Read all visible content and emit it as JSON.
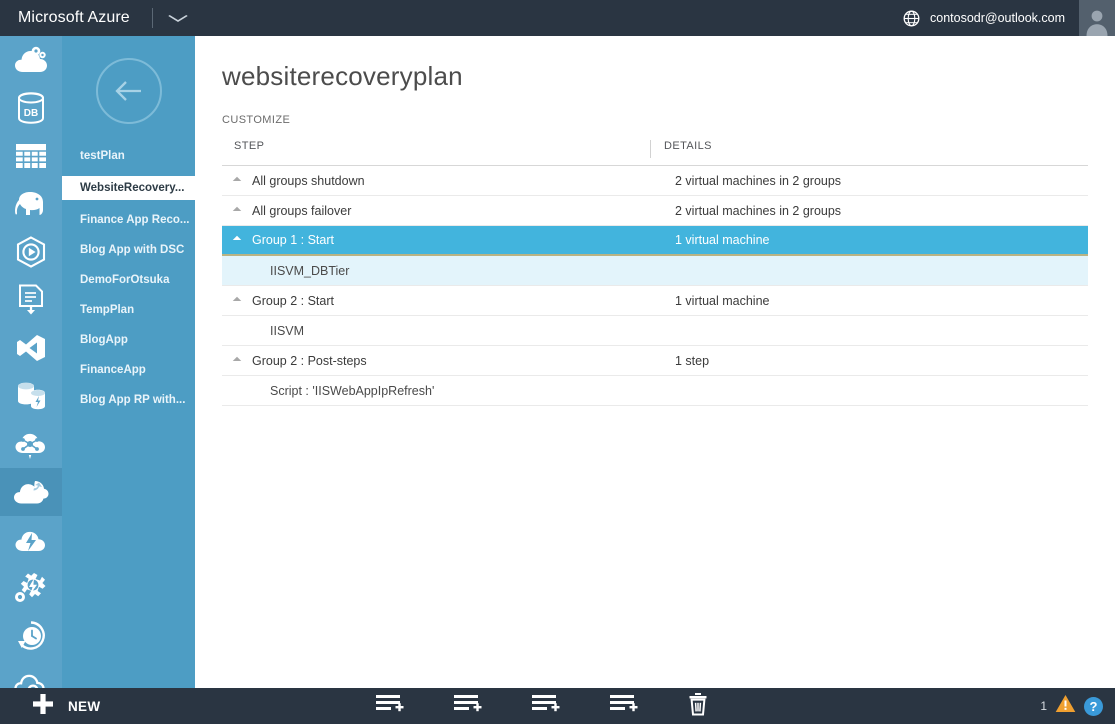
{
  "topbar": {
    "brand": "Microsoft Azure",
    "chevron_icon": "chevron-down-icon",
    "globe_icon": "globe-icon",
    "account": "contosodr@outlook.com",
    "avatar_icon": "user-avatar-icon"
  },
  "rail": {
    "items": [
      {
        "icon": "cloud-services-icon",
        "active": false
      },
      {
        "icon": "sql-database-icon",
        "active": false
      },
      {
        "icon": "storage-table-icon",
        "active": false
      },
      {
        "icon": "hdinsight-elephant-icon",
        "active": false
      },
      {
        "icon": "media-services-icon",
        "active": false
      },
      {
        "icon": "import-export-icon",
        "active": false
      },
      {
        "icon": "visual-studio-icon",
        "active": false
      },
      {
        "icon": "cache-storage-icon",
        "active": false
      },
      {
        "icon": "virtual-network-cloud-icon",
        "active": false
      },
      {
        "icon": "recovery-services-cloud-icon",
        "active": true
      },
      {
        "icon": "cloud-power-icon",
        "active": false
      },
      {
        "icon": "automation-gear-icon",
        "active": false
      },
      {
        "icon": "scheduler-clock-icon",
        "active": false
      },
      {
        "icon": "cloud-link-icon",
        "active": false
      }
    ]
  },
  "sidebar": {
    "back_icon": "back-arrow-icon",
    "items": [
      {
        "label": "testPlan",
        "selected": false
      },
      {
        "label": "WebsiteRecovery...",
        "selected": true
      },
      {
        "label": "Finance App Reco...",
        "selected": false
      },
      {
        "label": "Blog App with DSC",
        "selected": false
      },
      {
        "label": "DemoForOtsuka",
        "selected": false
      },
      {
        "label": "TempPlan",
        "selected": false
      },
      {
        "label": "BlogApp",
        "selected": false
      },
      {
        "label": "FinanceApp",
        "selected": false
      },
      {
        "label": "Blog App RP with...",
        "selected": false
      }
    ]
  },
  "main": {
    "title": "websiterecoveryplan",
    "section_label": "CUSTOMIZE",
    "table": {
      "columns": [
        "STEP",
        "DETAILS"
      ],
      "rows": [
        {
          "step": "All groups shutdown",
          "details": "2 virtual machines in 2 groups",
          "expandable": true,
          "child": false,
          "selected": false
        },
        {
          "step": "All groups failover",
          "details": "2 virtual machines in 2 groups",
          "expandable": true,
          "child": false,
          "selected": false
        },
        {
          "step": "Group 1 : Start",
          "details": "1 virtual machine",
          "expandable": true,
          "child": false,
          "selected": true
        },
        {
          "step": "IISVM_DBTier",
          "details": "",
          "expandable": false,
          "child": true,
          "selected": false
        },
        {
          "step": "Group 2 : Start",
          "details": "1 virtual machine",
          "expandable": true,
          "child": false,
          "selected": false
        },
        {
          "step": "IISVM",
          "details": "",
          "expandable": false,
          "child": true,
          "selected": false
        },
        {
          "step": "Group 2 : Post-steps",
          "details": "1 step",
          "expandable": true,
          "child": false,
          "selected": false
        },
        {
          "step": "Script : 'IISWebAppIpRefresh'",
          "details": "",
          "expandable": false,
          "child": true,
          "selected": false
        }
      ]
    }
  },
  "cmdbar": {
    "new_label": "NEW",
    "new_icon": "plus-icon",
    "commands": [
      {
        "icon": "add-step-list-icon"
      },
      {
        "icon": "add-step-list-icon"
      },
      {
        "icon": "add-step-list-icon"
      },
      {
        "icon": "add-step-list-icon"
      },
      {
        "icon": "delete-trash-icon"
      }
    ],
    "warning_count": "1",
    "warning_icon": "warning-triangle-icon",
    "help_label": "?",
    "help_icon": "help-icon"
  },
  "colors": {
    "topbar": "#2a3542",
    "rail": "#5ba3c9",
    "rail_active": "#4a92b8",
    "sidebar": "#4d9dc4",
    "row_selected": "#42b4dd",
    "row_selected_border": "#b9b383",
    "row_child_tint": "#e3f4fb",
    "accent_help": "#3a9ad9",
    "warning": "#f0a030"
  }
}
